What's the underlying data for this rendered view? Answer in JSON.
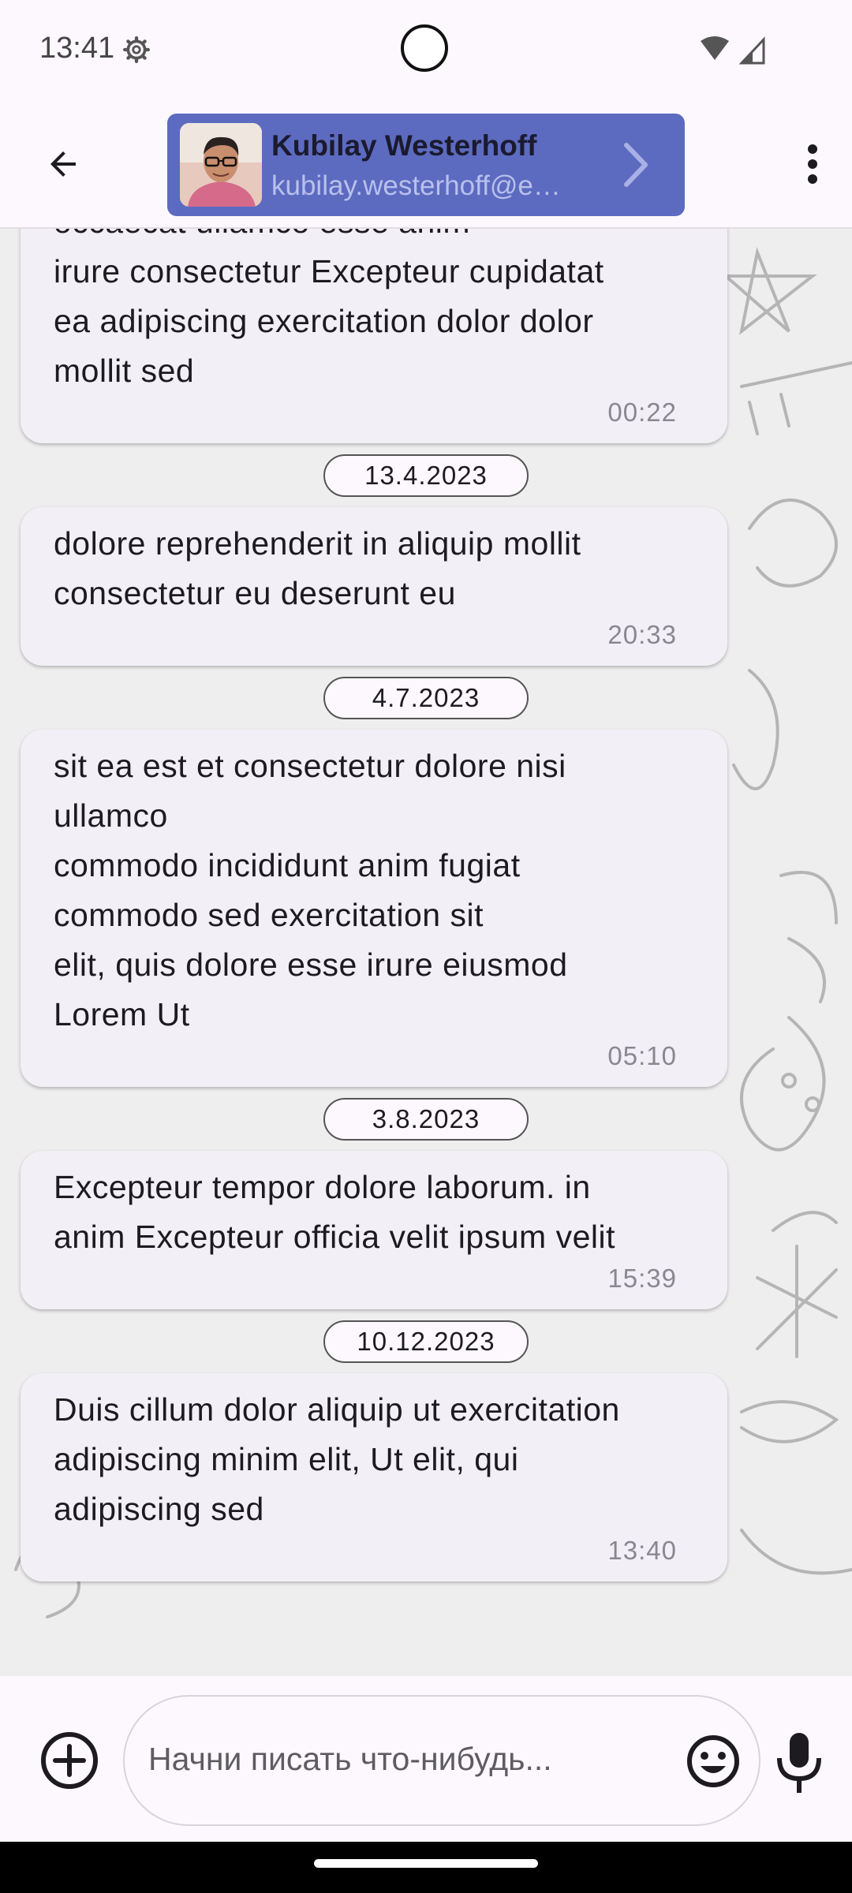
{
  "status_bar": {
    "time": "13:41"
  },
  "header": {
    "contact_name": "Kubilay Westerhoff",
    "contact_email": "kubilay.westerhoff@e…",
    "card_color": "#5c6bc0"
  },
  "messages": [
    {
      "text": "occaecat ullamco esse anim\nirure consectetur Excepteur cupidatat\nea adipiscing exercitation dolor dolor\nmollit sed",
      "time": "00:22"
    },
    {
      "date": "13.4.2023",
      "text": "dolore reprehenderit in aliquip mollit\nconsectetur eu deserunt eu",
      "time": "20:33"
    },
    {
      "date": "4.7.2023",
      "text": "sit ea est et consectetur dolore nisi\nullamco\ncommodo incididunt anim fugiat\ncommodo sed exercitation sit\nelit, quis dolore esse irure eiusmod\nLorem Ut",
      "time": "05:10"
    },
    {
      "date": "3.8.2023",
      "text": "Excepteur tempor dolore laborum. in\nanim Excepteur officia velit ipsum velit",
      "time": "15:39"
    },
    {
      "date": "10.12.2023",
      "text": "Duis cillum dolor aliquip ut exercitation\nadipiscing minim elit, Ut elit, qui\nadipiscing sed",
      "time": "13:40"
    }
  ],
  "composer": {
    "placeholder": "Начни писать что-нибудь..."
  },
  "icons": {
    "back": "arrow-left-icon",
    "more": "more-vert-icon",
    "open_contact": "chevron-right-icon",
    "add": "add-circle-icon",
    "emoji": "emoji-icon",
    "mic": "microphone-icon"
  }
}
